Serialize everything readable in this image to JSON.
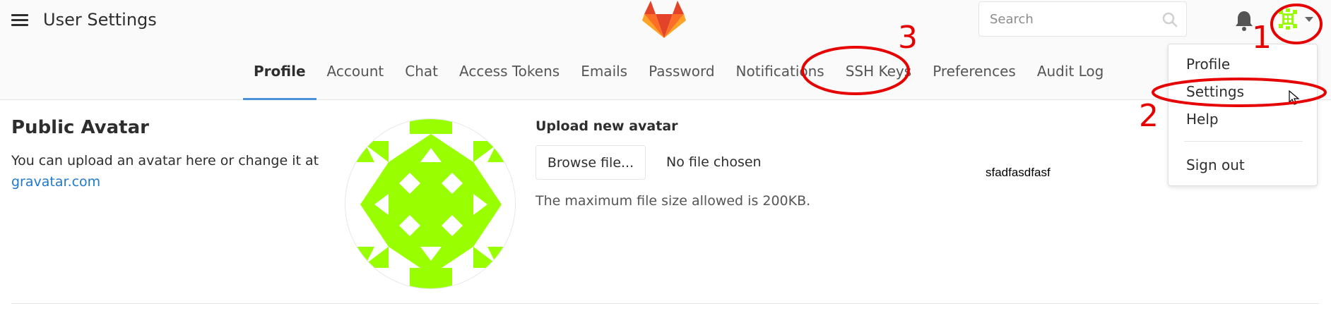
{
  "header": {
    "title": "User Settings",
    "search_placeholder": "Search",
    "menu_icon": "hamburger-menu-icon",
    "logo_icon": "gitlab-tanuki-logo",
    "bell_icon": "bell-icon",
    "avatar_icon": "identicon-avatar",
    "caret_icon": "caret-down-icon"
  },
  "tabs": [
    {
      "label": "Profile",
      "active": true
    },
    {
      "label": "Account"
    },
    {
      "label": "Chat"
    },
    {
      "label": "Access Tokens"
    },
    {
      "label": "Emails"
    },
    {
      "label": "Password"
    },
    {
      "label": "Notifications"
    },
    {
      "label": "SSH Keys"
    },
    {
      "label": "Preferences"
    },
    {
      "label": "Audit Log"
    }
  ],
  "avatar_section": {
    "title": "Public Avatar",
    "description": "You can upload an avatar here or change it at",
    "link_text": "gravatar.com",
    "upload_label": "Upload new avatar",
    "browse_label": "Browse file...",
    "file_status": "No file chosen",
    "help": "The maximum file size allowed is 200KB.",
    "stray_text": "sfadfasdfasf"
  },
  "dropdown": {
    "items": [
      {
        "label": "Profile"
      },
      {
        "label": "Settings"
      },
      {
        "label": "Help"
      },
      {
        "label": "Sign out"
      }
    ]
  },
  "annotations": {
    "numbers": [
      "1",
      "2",
      "3"
    ],
    "color": "#e60000"
  },
  "colors": {
    "accent_tab_underline": "#4a90d9",
    "link": "#1f78d1",
    "identicon": "#99ff00",
    "logo_orange": "#fc6d26",
    "logo_red": "#e24329",
    "logo_light": "#fca326"
  }
}
